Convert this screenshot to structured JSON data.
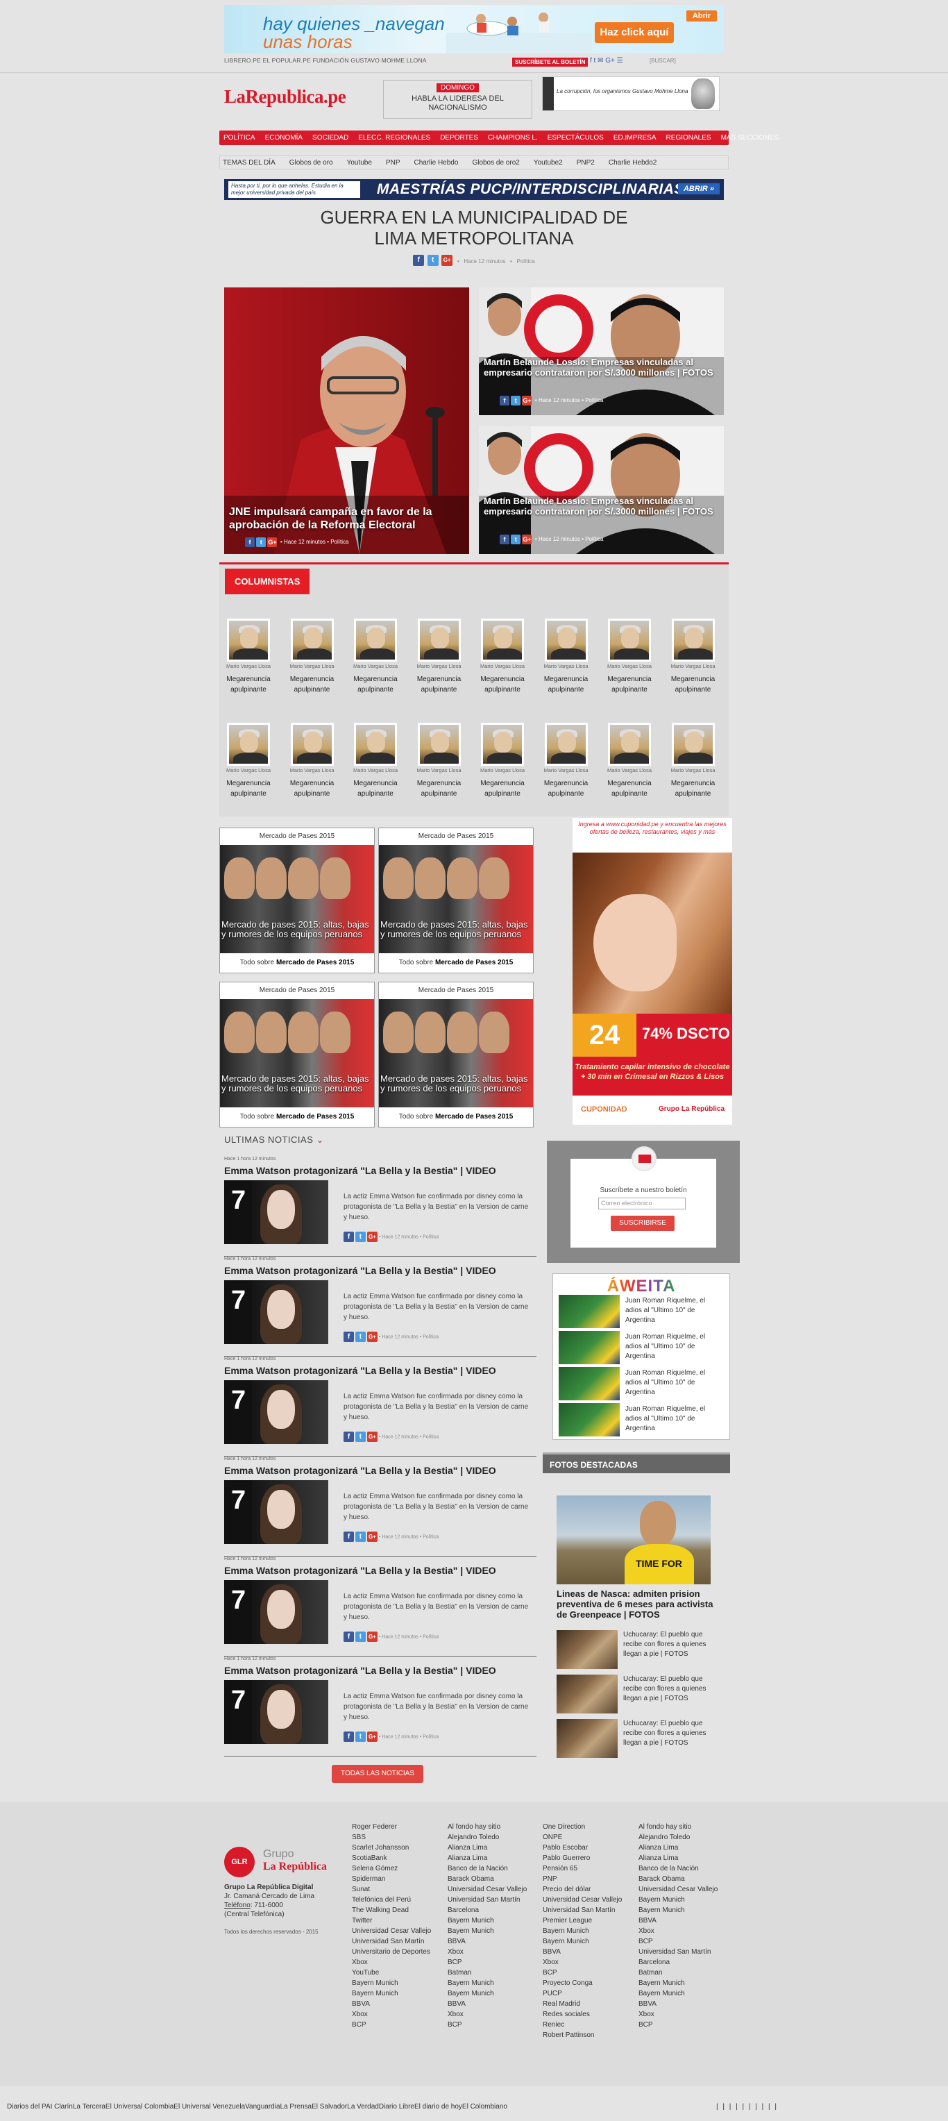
{
  "top": {
    "banner_line1": "hay quienes _navegan",
    "banner_line2": "unas horas",
    "banner_button": "Haz click aquí",
    "banner_open": "Abrir",
    "links": "LIBRERO.PE  EL POPULAR.PE  FUNDACIÓN GUSTAVO MOHME LLONA",
    "subscribe": "SUSCRÍBETE AL BOLETÍN",
    "social": "f  t  ✉  G+  ☰",
    "search": "[BUSCAR]"
  },
  "header": {
    "logo": "LaRepublica.pe",
    "promo_tag": "DOMINGO",
    "promo_text": "HABLA LA LIDERESA DEL NACIONALISMO",
    "book_text": "La corrupción, los organismos Gustavo Mohme Llona"
  },
  "nav": [
    "POLÍTICA",
    "ECONOMÍA",
    "SOCIEDAD",
    "ELECC. REGIONALES",
    "DEPORTES",
    "CHAMPIONS L.",
    "ESPECTÁCULOS",
    "ED.IMPRESA",
    "REGIONALES",
    "MÁS SECCIONES"
  ],
  "subnav": [
    "TEMAS DEL DÍA",
    "Globos de oro",
    "Youtube",
    "PNP",
    "Charlie Hebdo",
    "Globos de oro2",
    "Youtube2",
    "PNP2",
    "Charlie Hebdo2"
  ],
  "banner_mba": {
    "small": "Hasta por ti, por lo que anhelas. Estudia en la mejor universidad privada del país",
    "big": "MAESTRÍAS PUCP/INTERDISCIPLINARIAS",
    "button": "ABRIR »"
  },
  "headline": {
    "title": "GUERRA EN LA MUNICIPALIDAD DE LIMA METROPOLITANA",
    "time": "Hace 12 minutos",
    "section": "Política"
  },
  "featured": {
    "main_title": "JNE impulsará campaña en favor de la aprobación de la Reforma Electoral",
    "side_title": "Martín Belaunde Lossio: Empresas vinculadas al empresario contrataron por S/.3000 millones | FOTOS",
    "time": "Hace 12 minutos",
    "section": "Política"
  },
  "columnistas": {
    "title": "COLUMNISTAS",
    "author": "Mario Vargas Llosa",
    "text": "Megarenuncia apulpinante"
  },
  "mercado": {
    "header": "Mercado de Pases 2015",
    "title": "Mercado de pases 2015: altas, bajas y rumores de los equipos peruanos",
    "footer_prefix": "Todo sobre",
    "footer_bold": "Mercado de Pases 2015"
  },
  "cuponidad": {
    "top": "Ingresa a www.cuponidad.pe y encuentra las mejores ofertas de belleza, restaurantes, viajes y más",
    "price": "24",
    "discount": "74% DSCTO",
    "desc": "Tratamiento capilar intensivo de chocolate + 30 min en Crimesal en Rizzos & Lisos",
    "logo1": "CUPONIDAD",
    "logo2": "Grupo La República"
  },
  "ultimas": {
    "title": "ULTIMAS NOTICIAS",
    "time": "Hace 1 hora 12 minutos",
    "headline": "Emma Watson protagonizará \"La Bella y la Bestia\" | VIDEO",
    "desc": "La actiz Emma Watson fue confirmada por disney como la protagonista de \"La Bella y la Bestia\" en la Version de carne y hueso.",
    "meta_time": "Hace 12 minutos",
    "meta_section": "Política",
    "all_button": "TODAS LAS NOTICIAS"
  },
  "suscr": {
    "label": "Suscríbete a nuestro boletín",
    "placeholder": "Correo electrónico",
    "button": "SUSCRIBIRSE"
  },
  "aweita": {
    "logo": "ÁWEITA",
    "item": "Juan Roman Riquelme, el adios al \"Ultimo 10\" de Argentina"
  },
  "fotos": {
    "title": "FOTOS DESTACADAS",
    "shirt": "TIME FOR",
    "big_title": "Lineas de Nasca: admiten prision preventiva de 6 meses para activista de Greenpeace | FOTOS",
    "small": "Uchucaray: El pueblo que recibe con flores a quienes llegan a pie | FOTOS"
  },
  "footer": {
    "logo_circle": "GLR",
    "group1": "Grupo",
    "group2": "La República",
    "company": "Grupo La República Digital",
    "address": "Jr. Camaná Cercado de Lima",
    "phone_label": "Teléfono",
    "phone": ": 711-6000",
    "central": "(Central Telefónica)",
    "copyright": "Todos los derechos reservados - 2015",
    "col1": [
      "Roger Federer",
      "SBS",
      "Scarlet Johansson",
      "ScotiaBank",
      "Selena Gómez",
      "Spiderman",
      "Sunat",
      "Telefónica del Perú",
      "The Walking Dead",
      "Twitter",
      "Universidad Cesar Vallejo",
      "Universidad San Martín",
      "Universitario de Deportes",
      "Xbox",
      "YouTube",
      "Bayern Munich",
      "Bayern Munich",
      "BBVA",
      "Xbox",
      "BCP"
    ],
    "col2": [
      "Al fondo hay sitio",
      "Alejandro Toledo",
      "Alianza Lima",
      "Alianza Lima",
      "Banco de la Nación",
      "Barack Obama",
      "Universidad Cesar Vallejo",
      "Universidad San Martín",
      "Barcelona",
      "Bayern Munich",
      "Bayern Munich",
      "BBVA",
      "Xbox",
      "BCP",
      "Batman",
      "Bayern Munich",
      "Bayern Munich",
      "BBVA",
      "Xbox",
      "BCP"
    ],
    "col3": [
      "One Direction",
      "ONPE",
      "Pablo Escobar",
      "Pablo Guerrero",
      "Pensión 65",
      "PNP",
      "Precio del dólar",
      "Universidad Cesar Vallejo",
      "Universidad San Martín",
      "Premier League",
      "Bayern Munich",
      "Bayern Munich",
      "BBVA",
      "Xbox",
      "BCP",
      "Proyecto Conga",
      "PUCP",
      "Real Madrid",
      "Redes sociales",
      "Reniec",
      "Robert Pattinson"
    ],
    "col4": [
      "Al fondo hay sitio",
      "Alejandro Toledo",
      "Alianza Lima",
      "Alianza Lima",
      "Banco de la Nación",
      "Barack Obama",
      "Universidad Cesar Vallejo",
      "Bayern Munich",
      "Bayern Munich",
      "BBVA",
      "Xbox",
      "BCP",
      "Universidad San Martín",
      "Barcelona",
      "Batman",
      "Bayern Munich",
      "Bayern Munich",
      "BBVA",
      "Xbox",
      "BCP"
    ],
    "bottom_links": "Diarios del PAI ClarínLa TerceraEl Universal ColombiaEl Universal VenezuelaVanguardiaLa PrensaEl SalvadorLa VerdadDiario LibreEl diario de hoyEl Colombiano",
    "bottom_right": "| | | | | | | | | |"
  }
}
